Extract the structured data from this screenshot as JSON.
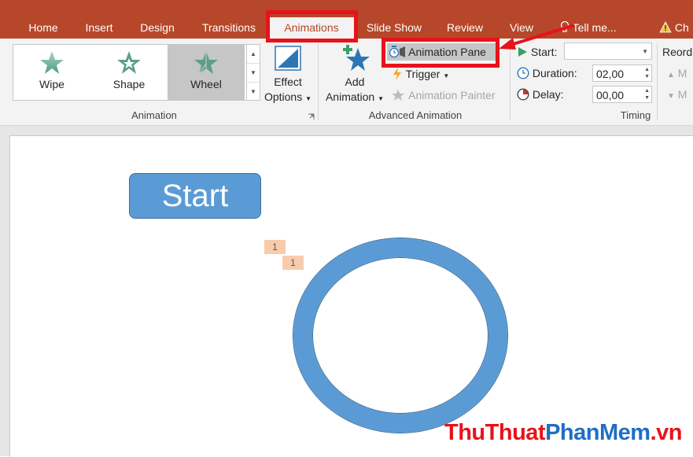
{
  "tabs": [
    {
      "label": "Home"
    },
    {
      "label": "Insert"
    },
    {
      "label": "Design"
    },
    {
      "label": "Transitions"
    },
    {
      "label": "Animations"
    },
    {
      "label": "Slide Show"
    },
    {
      "label": "Review"
    },
    {
      "label": "View"
    }
  ],
  "tell_me": "Tell me...",
  "share_label": "Ch",
  "animation_group": {
    "label": "Animation",
    "effects": [
      {
        "label": "Wipe"
      },
      {
        "label": "Shape"
      },
      {
        "label": "Wheel"
      }
    ],
    "effect_options": {
      "line1": "Effect",
      "line2": "Options"
    }
  },
  "advanced_group": {
    "label": "Advanced Animation",
    "add_animation": {
      "line1": "Add",
      "line2": "Animation"
    },
    "animation_pane": "Animation Pane",
    "trigger": "Trigger",
    "animation_painter": "Animation Painter"
  },
  "timing_group": {
    "label": "Timing",
    "start_label": "Start:",
    "start_value": "",
    "duration_label": "Duration:",
    "duration_value": "02,00",
    "delay_label": "Delay:",
    "delay_value": "00,00",
    "reorder_label": "Reord",
    "move_earlier": "M",
    "move_later": "M"
  },
  "slide": {
    "start_button_text": "Start",
    "tag1": "1",
    "tag2": "1"
  },
  "watermark": {
    "part1": "ThuThuat",
    "part2": "PhanMem",
    "part3": ".vn"
  },
  "colors": {
    "accent": "#b7472a",
    "shape_fill": "#5b9bd5",
    "highlight": "#e8121a",
    "tag": "#f8cbad"
  }
}
